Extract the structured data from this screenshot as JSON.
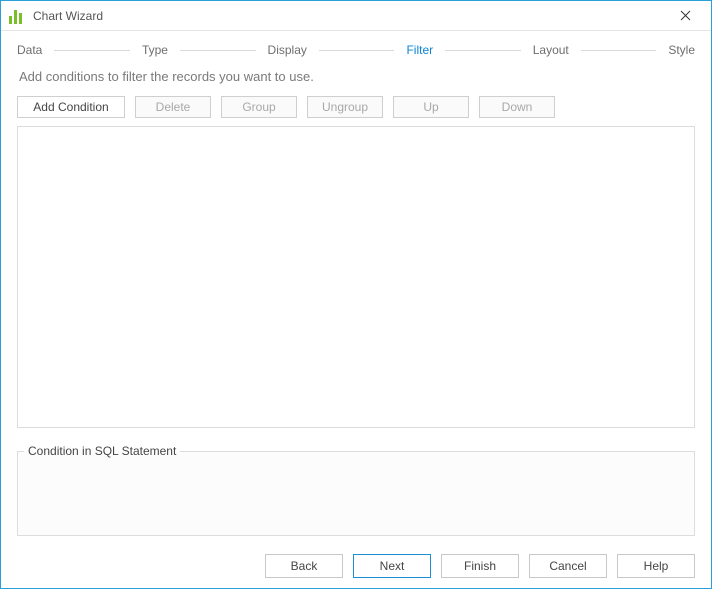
{
  "window": {
    "title": "Chart Wizard"
  },
  "steps": {
    "data": "Data",
    "type": "Type",
    "display": "Display",
    "filter": "Filter",
    "layout": "Layout",
    "style": "Style",
    "active": "filter"
  },
  "instruction": "Add conditions to filter the records you want to use.",
  "toolbar": {
    "add": "Add Condition",
    "delete": "Delete",
    "group": "Group",
    "ungroup": "Ungroup",
    "up": "Up",
    "down": "Down"
  },
  "sql": {
    "legend": "Condition in SQL Statement"
  },
  "nav": {
    "back": "Back",
    "next": "Next",
    "finish": "Finish",
    "cancel": "Cancel",
    "help": "Help"
  }
}
